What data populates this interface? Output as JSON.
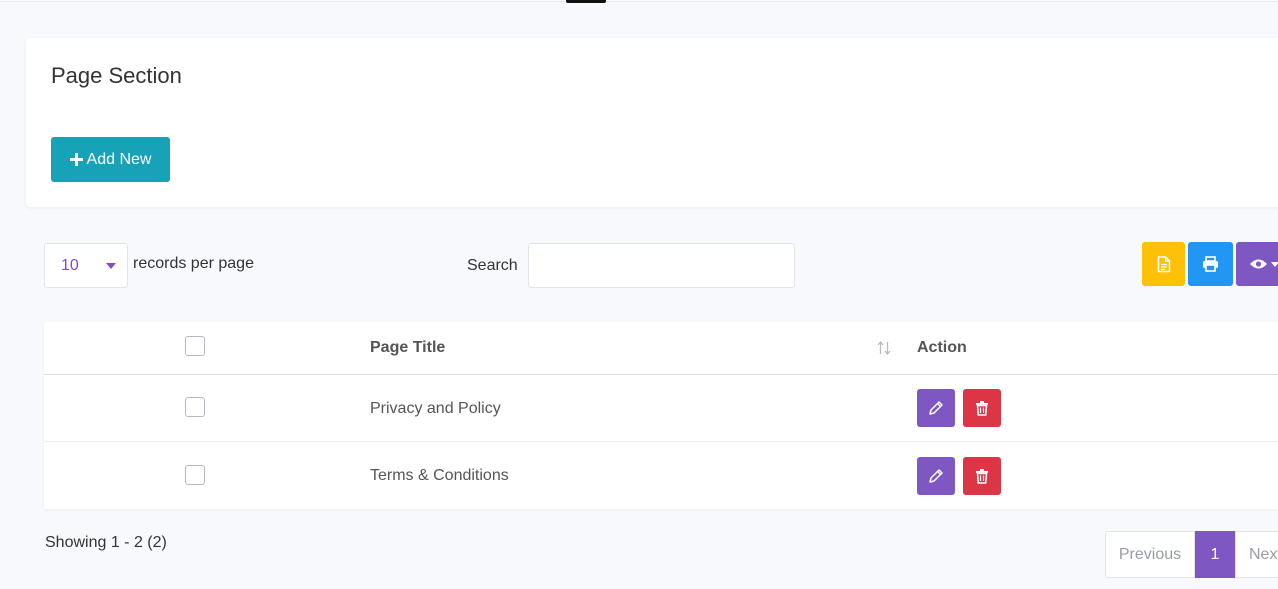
{
  "card": {
    "title": "Page Section",
    "add_label": "Add New"
  },
  "controls": {
    "page_size": "10",
    "records_label": "records per page",
    "search_label": "Search",
    "search_placeholder": ""
  },
  "toolbar": {
    "buttons": [
      {
        "icon": "file-icon",
        "color": "#ffc107"
      },
      {
        "icon": "printer-icon",
        "color": "#2196f3"
      },
      {
        "icon": "eye-icon",
        "color": "#7e57c2"
      }
    ]
  },
  "table": {
    "columns": [
      "Page Title",
      "Action"
    ],
    "rows": [
      {
        "title": "Privacy and Policy"
      },
      {
        "title": "Terms & Conditions"
      }
    ]
  },
  "footer": {
    "showing": "Showing 1 - 2 (2)"
  },
  "pagination": {
    "previous": "Previous",
    "current": "1",
    "next": "Next"
  },
  "colors": {
    "accent": "#7e57c2",
    "add_button": "#17a2b8",
    "delete": "#dc3545"
  }
}
